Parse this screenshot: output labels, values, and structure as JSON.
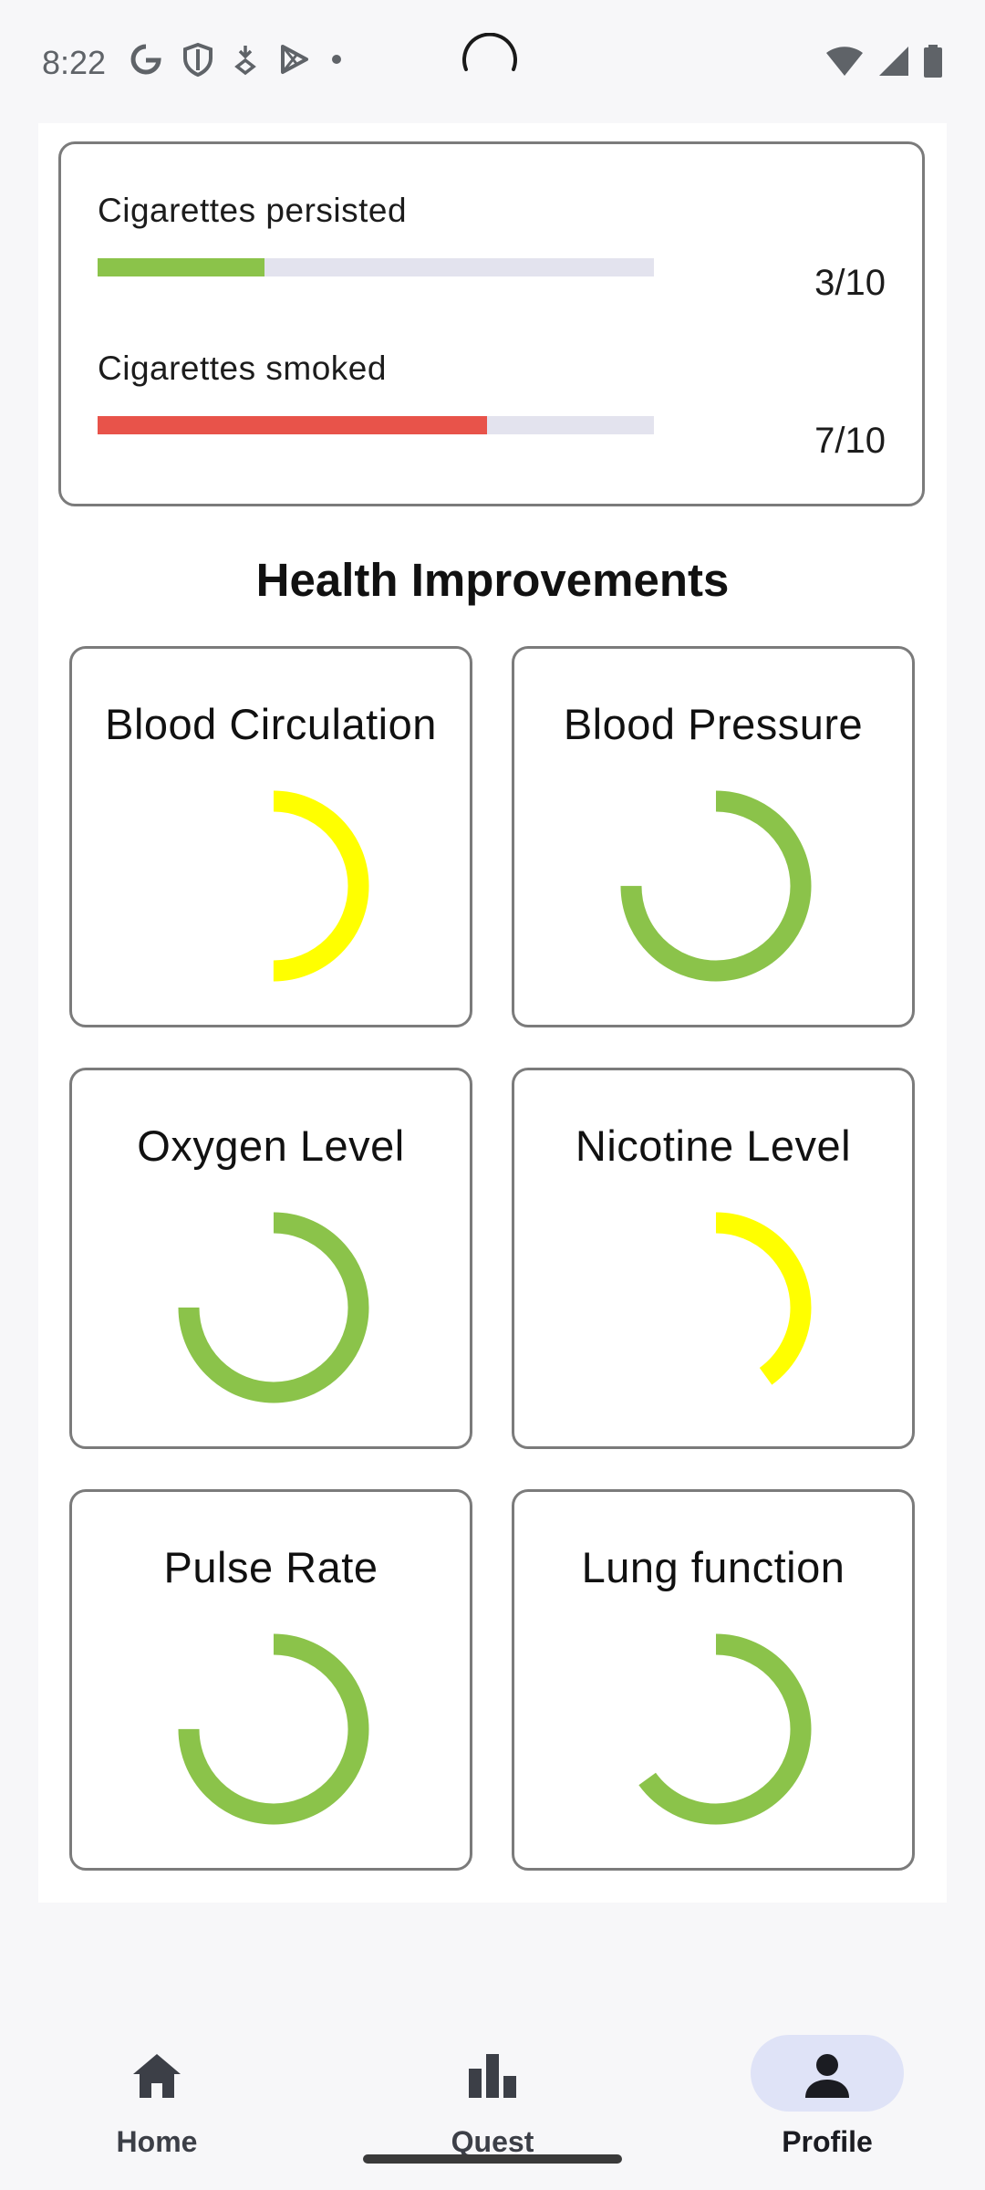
{
  "status_bar": {
    "time": "8:22",
    "left_icons": [
      "google-icon",
      "shield-icon",
      "download-alert-icon",
      "play-store-icon",
      "dot-icon"
    ],
    "right_icons": [
      "wifi-icon",
      "signal-icon",
      "battery-icon"
    ]
  },
  "stats": {
    "items": [
      {
        "label": "Cigarettes persisted",
        "value_text": "3/10",
        "progress": 0.3,
        "color": "#8bc34a"
      },
      {
        "label": "Cigarettes smoked",
        "value_text": "7/10",
        "progress": 0.7,
        "color": "#e8534a"
      }
    ]
  },
  "health": {
    "title": "Health Improvements",
    "cards": [
      {
        "title": "Blood Circulation",
        "progress": 0.5,
        "color": "#ffff00"
      },
      {
        "title": "Blood Pressure",
        "progress": 0.75,
        "color": "#8bc34a"
      },
      {
        "title": "Oxygen Level",
        "progress": 0.75,
        "color": "#8bc34a"
      },
      {
        "title": "Nicotine Level",
        "progress": 0.4,
        "color": "#ffff00"
      },
      {
        "title": "Pulse Rate",
        "progress": 0.75,
        "color": "#8bc34a"
      },
      {
        "title": "Lung function",
        "progress": 0.65,
        "color": "#8bc34a"
      }
    ]
  },
  "bottom_nav": {
    "items": [
      {
        "label": "Home",
        "icon": "home-icon",
        "active": false
      },
      {
        "label": "Quest",
        "icon": "bar-chart-icon",
        "active": false
      },
      {
        "label": "Profile",
        "icon": "person-icon",
        "active": true
      }
    ],
    "active_color": "#dfe3f7"
  }
}
